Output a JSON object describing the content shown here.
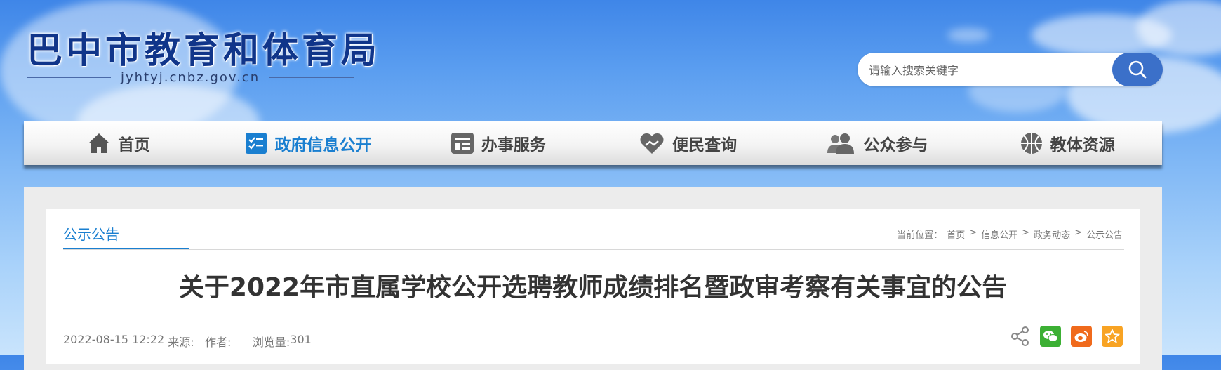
{
  "header": {
    "site_title": "巴中市教育和体育局",
    "domain": "jyhtyj.cnbz.gov.cn"
  },
  "search": {
    "placeholder": "请输入搜索关键字",
    "button_icon": "search-icon"
  },
  "nav": {
    "items": [
      {
        "label": "首页",
        "icon": "home-icon"
      },
      {
        "label": "政府信息公开",
        "icon": "info-checklist-icon",
        "active": true
      },
      {
        "label": "办事服务",
        "icon": "service-card-icon"
      },
      {
        "label": "便民查询",
        "icon": "heart-hand-icon"
      },
      {
        "label": "公众参与",
        "icon": "people-icon"
      },
      {
        "label": "教体资源",
        "icon": "basketball-icon"
      }
    ]
  },
  "section": {
    "title": "公示公告"
  },
  "breadcrumb": {
    "prefix": "当前位置：",
    "items": [
      "首页",
      "信息公开",
      "政务动态",
      "公示公告"
    ],
    "separator": ">"
  },
  "article": {
    "title": "关于2022年市直属学校公开选聘教师成绩排名暨政审考察有关事宜的公告",
    "datetime": "2022-08-15 12:22",
    "source_label": "来源:",
    "author_label": "作者:",
    "views_label": "浏览量:",
    "views": "301"
  },
  "share": {
    "icons": [
      "share-icon",
      "wechat-icon",
      "weibo-icon",
      "favorite-star-icon"
    ]
  },
  "colors": {
    "accent": "#1a7fd0",
    "logo": "#10358a",
    "search_button": "#3b70c9",
    "wechat": "#3cb034",
    "weibo": "#f06a1c",
    "favorite": "#f8a323"
  }
}
